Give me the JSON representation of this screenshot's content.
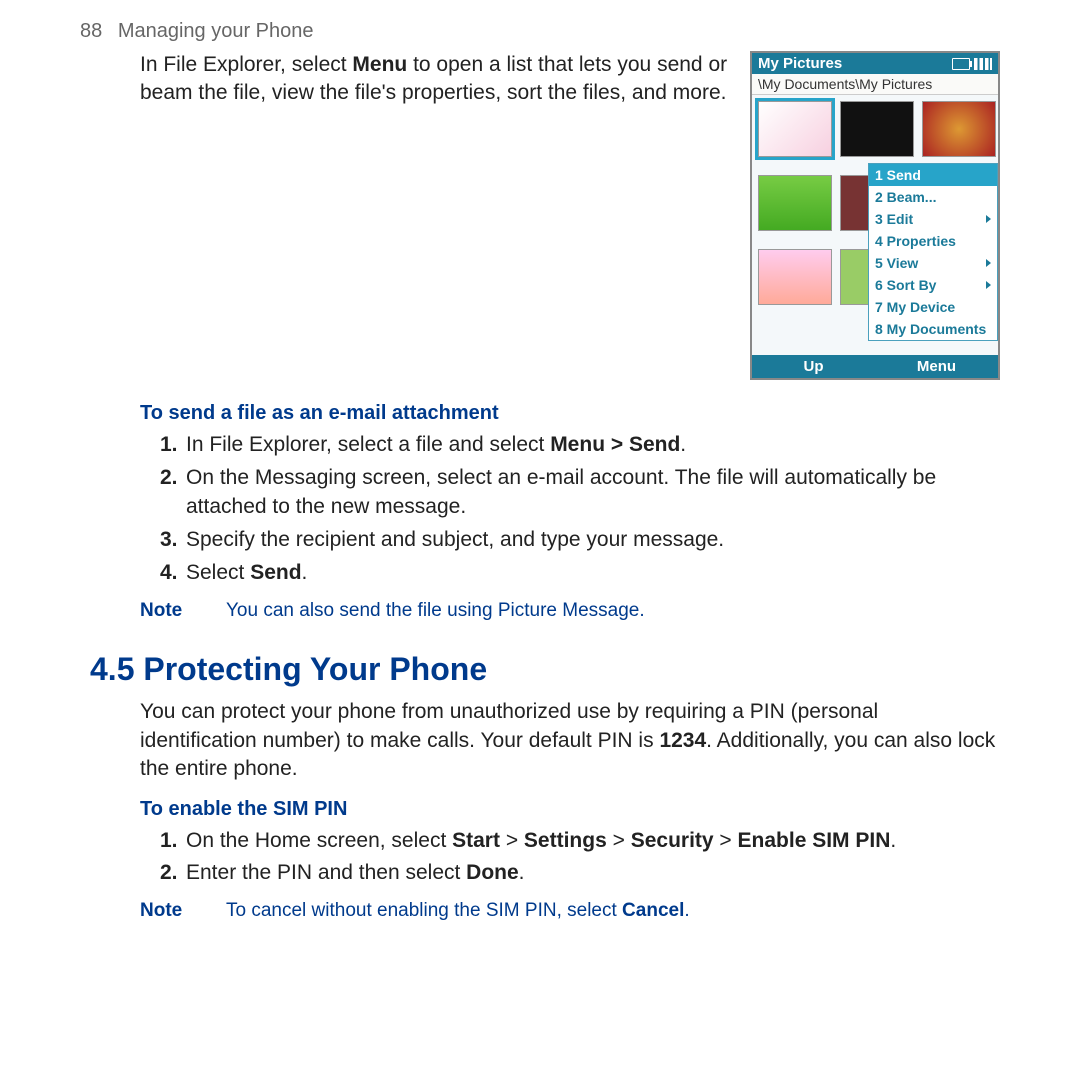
{
  "header": {
    "page_number": "88",
    "chapter": "Managing your Phone"
  },
  "intro_para": {
    "pre": "In File Explorer, select ",
    "bold1": "Menu",
    "post": " to open a list that lets you send or beam the file, view the file's properties, sort the files, and more."
  },
  "screenshot": {
    "title": "My Pictures",
    "path": "\\My Documents\\My Pictures",
    "menu": [
      {
        "label": "1 Send",
        "hl": true,
        "arrow": false
      },
      {
        "label": "2 Beam...",
        "hl": false,
        "arrow": false
      },
      {
        "label": "3 Edit",
        "hl": false,
        "arrow": true
      },
      {
        "label": "4 Properties",
        "hl": false,
        "arrow": false
      },
      {
        "label": "5 View",
        "hl": false,
        "arrow": true
      },
      {
        "label": "6 Sort By",
        "hl": false,
        "arrow": true
      },
      {
        "label": "7 My Device",
        "hl": false,
        "arrow": false
      },
      {
        "label": "8 My Documents",
        "hl": false,
        "arrow": false
      }
    ],
    "softkeys": {
      "left": "Up",
      "right": "Menu"
    }
  },
  "subhead1": "To send a file as an e-mail attachment",
  "steps1": {
    "s1_pre": "In File Explorer, select a file and select ",
    "s1_bold": "Menu > Send",
    "s1_post": ".",
    "s2": "On the Messaging screen, select an e-mail account. The file will automatically be attached to the new message.",
    "s3": "Specify the recipient and subject, and type your message.",
    "s4_pre": "Select ",
    "s4_bold": "Send",
    "s4_post": "."
  },
  "note1": {
    "label": "Note",
    "text": "You can also send the file using Picture Message."
  },
  "section_heading": "4.5  Protecting Your Phone",
  "protect_para": {
    "pre": "You can protect your phone from unauthorized use by requiring a PIN (personal identification number) to make calls. Your default PIN is ",
    "bold1": "1234",
    "post": ". Additionally, you can also lock the entire phone."
  },
  "subhead2": "To enable the SIM PIN",
  "steps2": {
    "s1_pre": "On the Home screen, select ",
    "s1_b1": "Start",
    "s1_g1": " > ",
    "s1_b2": "Settings",
    "s1_g2": " > ",
    "s1_b3": "Security",
    "s1_g3": " > ",
    "s1_b4": "Enable SIM PIN",
    "s1_post": ".",
    "s2_pre": "Enter the PIN and then select ",
    "s2_bold": "Done",
    "s2_post": "."
  },
  "note2": {
    "label": "Note",
    "pre": "To cancel without enabling the SIM PIN, select ",
    "bold": "Cancel",
    "post": "."
  },
  "nums": {
    "n1": "1.",
    "n2": "2.",
    "n3": "3.",
    "n4": "4."
  }
}
